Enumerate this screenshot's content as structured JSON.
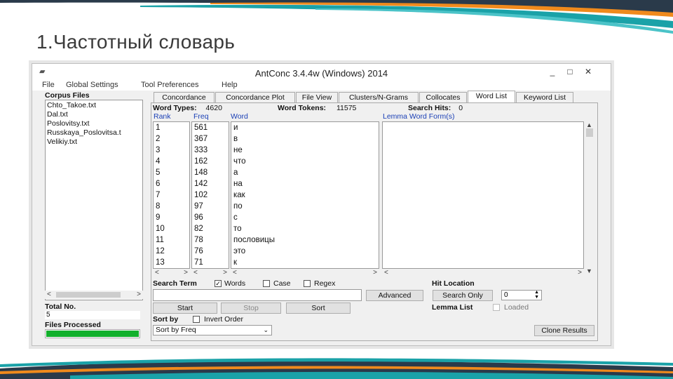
{
  "slide": {
    "title": "1.Частотный словарь"
  },
  "window": {
    "title": "AntConc 3.4.4w (Windows) 2014",
    "controls": {
      "minimize": "_",
      "maximize": "□",
      "close": "✕"
    }
  },
  "menu": [
    "File",
    "Global Settings",
    "Tool Preferences",
    "Help"
  ],
  "left_panel": {
    "corpus_label": "Corpus Files",
    "files": [
      "Chto_Takoe.txt",
      "Dal.txt",
      "Poslovitsy.txt",
      "Russkaya_Poslovitsa.t",
      "Velikiy.txt"
    ],
    "total_label": "Total No.",
    "total_value": "5",
    "files_processed_label": "Files Processed",
    "progress": 1.0
  },
  "tabs": [
    "Concordance",
    "Concordance Plot",
    "File View",
    "Clusters/N-Grams",
    "Collocates",
    "Word List",
    "Keyword List"
  ],
  "active_tab": "Word List",
  "stats": {
    "word_types_label": "Word Types:",
    "word_types": "4620",
    "word_tokens_label": "Word Tokens:",
    "word_tokens": "11575",
    "search_hits_label": "Search Hits:",
    "search_hits": "0"
  },
  "columns": {
    "rank": "Rank",
    "freq": "Freq",
    "word": "Word",
    "lemma": "Lemma Word Form(s)"
  },
  "rows": [
    {
      "rank": "1",
      "freq": "561",
      "word": "и"
    },
    {
      "rank": "2",
      "freq": "367",
      "word": "в"
    },
    {
      "rank": "3",
      "freq": "333",
      "word": "не"
    },
    {
      "rank": "4",
      "freq": "162",
      "word": "что"
    },
    {
      "rank": "5",
      "freq": "148",
      "word": "а"
    },
    {
      "rank": "6",
      "freq": "142",
      "word": "на"
    },
    {
      "rank": "7",
      "freq": "102",
      "word": "как"
    },
    {
      "rank": "8",
      "freq": "97",
      "word": "по"
    },
    {
      "rank": "9",
      "freq": "96",
      "word": "с"
    },
    {
      "rank": "10",
      "freq": "82",
      "word": "то"
    },
    {
      "rank": "11",
      "freq": "78",
      "word": "пословицы"
    },
    {
      "rank": "12",
      "freq": "76",
      "word": "это"
    },
    {
      "rank": "13",
      "freq": "71",
      "word": "к"
    }
  ],
  "search": {
    "term_label": "Search Term",
    "words_label": "Words",
    "words_checked": true,
    "case_label": "Case",
    "regex_label": "Regex",
    "advanced_label": "Advanced",
    "hit_location_label": "Hit Location",
    "search_only_label": "Search Only",
    "hit_value": "0",
    "start_label": "Start",
    "stop_label": "Stop",
    "sort_label": "Sort",
    "lemma_list_label": "Lemma List",
    "loaded_label": "Loaded",
    "sort_by_label": "Sort by",
    "invert_order_label": "Invert Order",
    "sort_by_value": "Sort by Freq",
    "clone_results_label": "Clone Results"
  },
  "colors": {
    "accent_teal": "#1aa2a8",
    "accent_orange": "#f08a1c",
    "progress_green": "#12b02c",
    "header_blue": "#1a3fb5"
  }
}
